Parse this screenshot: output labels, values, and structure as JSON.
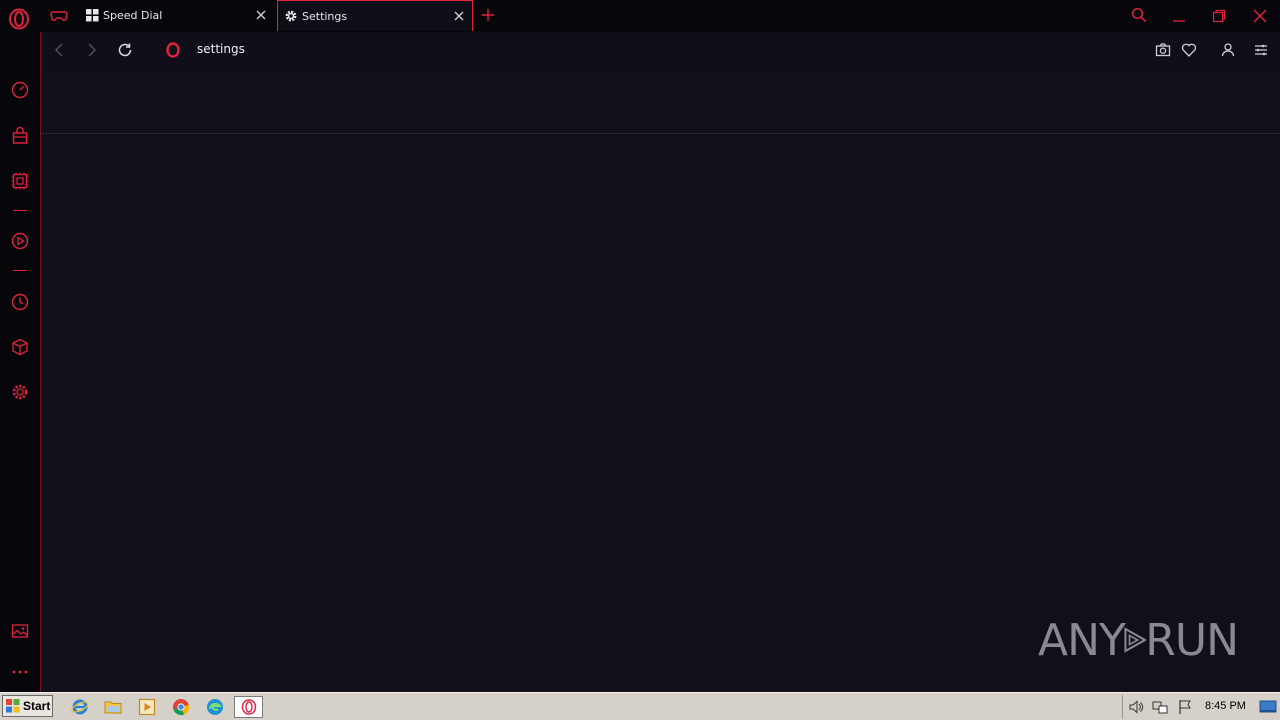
{
  "window": {
    "tabs": [
      {
        "label": "Speed Dial",
        "icon": "speed-dial-grid-icon",
        "active": false
      },
      {
        "label": "Settings",
        "icon": "settings-gear-icon",
        "active": true
      }
    ]
  },
  "toolbar": {
    "address": "settings"
  },
  "sidebar": {
    "items": [
      "speedometer-icon",
      "shopping-bag-icon",
      "crypto-wallet-icon",
      "player-icon",
      "history-icon",
      "extensions-cube-icon",
      "settings-icon",
      "pinboard-icon",
      "more-icon"
    ]
  },
  "watermark": {
    "text_left": "ANY",
    "text_right": "RUN"
  },
  "taskbar": {
    "start_label": "Start",
    "clock": "8:45 PM"
  },
  "colors": {
    "accent": "#e0233f",
    "background": "#110f1a",
    "taskbar": "#d5d0c8"
  }
}
